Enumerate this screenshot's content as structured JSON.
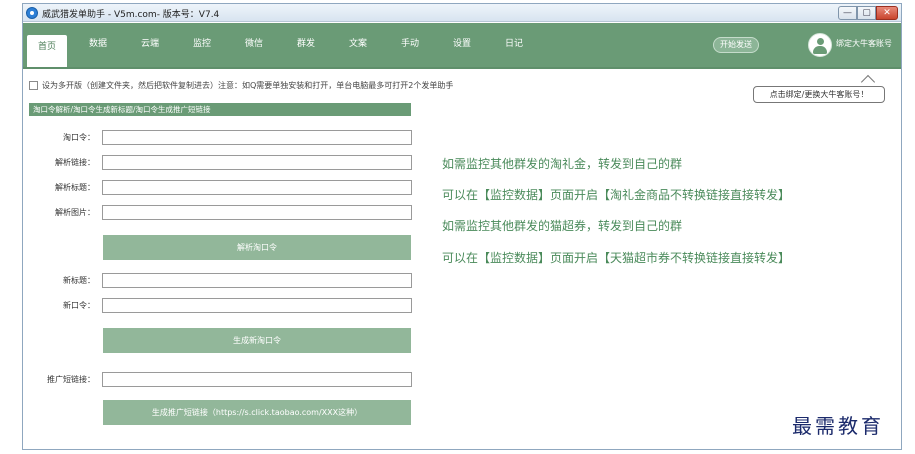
{
  "window": {
    "title": "威武猎发单助手 - V5m.com- 版本号：V7.4",
    "controls": {
      "minimize": "—",
      "maximize": "▢",
      "close": "✕"
    }
  },
  "nav": {
    "tabs": [
      {
        "label": "首页",
        "active": true
      },
      {
        "label": "数据",
        "active": false
      },
      {
        "label": "云端",
        "active": false
      },
      {
        "label": "监控",
        "active": false
      },
      {
        "label": "微信",
        "active": false
      },
      {
        "label": "群发",
        "active": false
      },
      {
        "label": "文案",
        "active": false
      },
      {
        "label": "手动",
        "active": false
      },
      {
        "label": "设置",
        "active": false
      },
      {
        "label": "日记",
        "active": false
      }
    ],
    "start_send": "开始发送",
    "bind_account": "绑定大牛客账号"
  },
  "content": {
    "multi_open_text": "设为多开版（创建文件夹，然后把软件复制进去）注意：如Q需要单独安装和打开，单台电脑最多可打开2个发单助手",
    "tooltip": "点击绑定/更换大牛客账号！",
    "group_header": "淘口令解析/淘口令生成新标题/淘口令生成推广短链接",
    "fields": {
      "taokouling": "淘口令：",
      "parse_link": "解析链接：",
      "parse_title": "解析标题：",
      "parse_image": "解析图片：",
      "new_title": "新标题：",
      "new_kouling": "新口令：",
      "short_link": "推广短链接："
    },
    "buttons": {
      "parse": "解析淘口令",
      "generate_kouling": "生成新淘口令",
      "generate_short": "生成推广短链接（https://s.click.taobao.com/XXX这种）"
    },
    "info_lines": [
      "如需监控其他群发的淘礼金，转发到自己的群",
      "可以在【监控数据】页面开启【淘礼金商品不转换链接直接转发】",
      "如需监控其他群发的猫超券，转发到自己的群",
      "可以在【监控数据】页面开启【天猫超市券不转换链接直接转发】"
    ]
  },
  "watermark": "最需教育"
}
